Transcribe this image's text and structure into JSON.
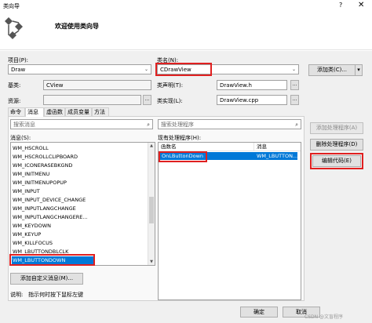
{
  "window": {
    "title": "类向导",
    "help": "?",
    "close": "✕"
  },
  "header": {
    "title": "欢迎使用类向导"
  },
  "project": {
    "label": "项目(P):",
    "value": "Draw"
  },
  "classname": {
    "label": "类名(N):",
    "value": "CDrawView"
  },
  "add_class_button": "添加类(C)...",
  "base": {
    "label": "基类:",
    "value": "CView"
  },
  "class_decl": {
    "label": "类声明(T):",
    "value": "DrawView.h"
  },
  "resource": {
    "label": "资源:"
  },
  "class_impl": {
    "label": "类实现(L):",
    "value": "DrawView.cpp"
  },
  "tabs": [
    "命令",
    "消息",
    "虚函数",
    "成员变量",
    "方法"
  ],
  "search_messages": {
    "placeholder": "搜索消息"
  },
  "search_handlers": {
    "placeholder": "搜索处理程序"
  },
  "messages": {
    "label": "消息(S):",
    "items": [
      "WM_HSCROLL",
      "WM_HSCROLLCLIPBOARD",
      "WM_ICONERASEBKGND",
      "WM_INITMENU",
      "WM_INITMENUPOPUP",
      "WM_INPUT",
      "WM_INPUT_DEVICE_CHANGE",
      "WM_INPUTLANGCHANGE",
      "WM_INPUTLANGCHANGERE...",
      "WM_KEYDOWN",
      "WM_KEYUP",
      "WM_KILLFOCUS",
      "WM_LBUTTONDBLCLK",
      "WM_LBUTTONDOWN"
    ],
    "selected_index": 13
  },
  "handlers": {
    "label": "现有处理程序(H):",
    "columns": [
      "函数名",
      "消息"
    ],
    "rows": [
      {
        "func": "OnLButtonDown",
        "msg": "WM_LBUTTON..."
      }
    ]
  },
  "buttons": {
    "add_handler": "添加处理程序(A)",
    "delete_handler": "删除处理程序(D)",
    "edit_code": "编辑代码(E)",
    "add_custom_message": "添加自定义消息(M)..."
  },
  "description": {
    "label": "说明:",
    "text": "指示何时按下鼠标左键"
  },
  "footer": {
    "ok": "确定",
    "cancel": "取消"
  },
  "watermark": "CSDN @文盲程序",
  "colors": {
    "selection": "#0078d7",
    "highlight_box": "#e02020"
  }
}
